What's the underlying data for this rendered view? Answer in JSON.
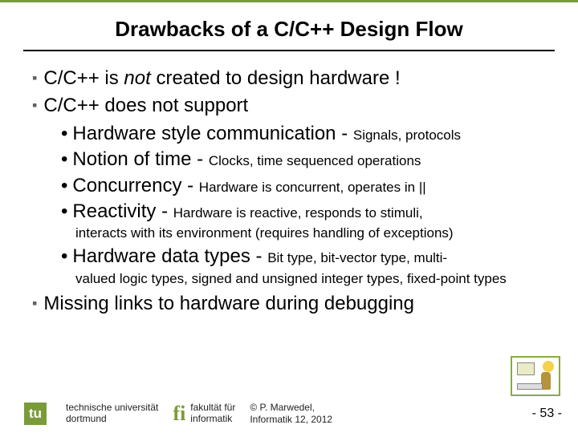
{
  "title": "Drawbacks of a C/C++ Design Flow",
  "bullets": {
    "b1_a": "C/C++ is ",
    "b1_em": "not",
    "b1_b": " created to design hardware !",
    "b2": "C/C++ does not support",
    "s1_main": "Hardware style communication - ",
    "s1_small": "Signals, protocols",
    "s2_main": "Notion of time - ",
    "s2_small": "Clocks, time sequenced operations",
    "s3_main": "Concurrency - ",
    "s3_small": "Hardware is concurrent, operates in ||",
    "s4_main": "Reactivity - ",
    "s4_small": "Hardware is reactive, responds to stimuli,",
    "s4_cont": "interacts with its environment (requires handling of exceptions)",
    "s5_main": "Hardware data types - ",
    "s5_small": "Bit type, bit-vector type, multi-",
    "s5_cont": "valued logic types, signed and unsigned integer types, fixed-point types",
    "b3": "Missing links to hardware during debugging"
  },
  "footer": {
    "tu_line1": "technische universität",
    "tu_line2": "dortmund",
    "fi_line1": "fakultät für",
    "fi_line2": "informatik",
    "copy_line1": "© P. Marwedel,",
    "copy_line2": "Informatik 12,  2012",
    "page": "-  53 -"
  }
}
